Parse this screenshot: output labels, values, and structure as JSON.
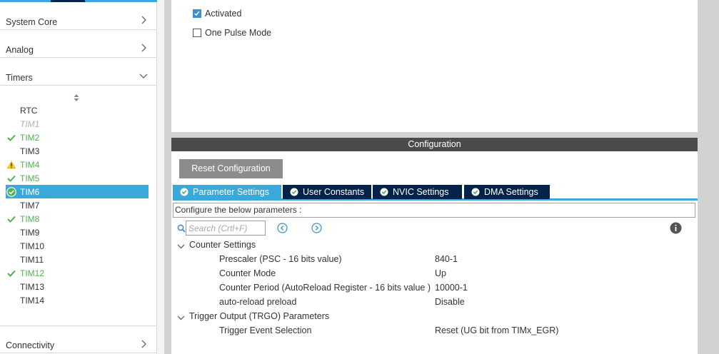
{
  "sidebar": {
    "categories": [
      {
        "label": "System Core",
        "state": "collapsed"
      },
      {
        "label": "Analog",
        "state": "collapsed"
      },
      {
        "label": "Timers",
        "state": "expanded"
      },
      {
        "label": "Connectivity",
        "state": "collapsed"
      }
    ],
    "timers": [
      {
        "label": "RTC",
        "status": "none"
      },
      {
        "label": "TIM1",
        "status": "disabled"
      },
      {
        "label": "TIM2",
        "status": "ok"
      },
      {
        "label": "TIM3",
        "status": "none"
      },
      {
        "label": "TIM4",
        "status": "warning"
      },
      {
        "label": "TIM5",
        "status": "ok"
      },
      {
        "label": "TIM6",
        "status": "selected"
      },
      {
        "label": "TIM7",
        "status": "none"
      },
      {
        "label": "TIM8",
        "status": "ok"
      },
      {
        "label": "TIM9",
        "status": "none"
      },
      {
        "label": "TIM10",
        "status": "none"
      },
      {
        "label": "TIM11",
        "status": "none"
      },
      {
        "label": "TIM12",
        "status": "ok"
      },
      {
        "label": "TIM13",
        "status": "none"
      },
      {
        "label": "TIM14",
        "status": "none"
      }
    ]
  },
  "mode": {
    "activated": {
      "label": "Activated",
      "checked": true
    },
    "one_pulse": {
      "label": "One Pulse Mode",
      "checked": false
    }
  },
  "config": {
    "header": "Configuration",
    "reset_button": "Reset Configuration",
    "tabs": [
      {
        "label": "Parameter Settings",
        "active": true
      },
      {
        "label": "User Constants",
        "active": false
      },
      {
        "label": "NVIC Settings",
        "active": false
      },
      {
        "label": "DMA Settings",
        "active": false
      }
    ],
    "describe": "Configure the below parameters :",
    "search_placeholder": "Search (Crtl+F)",
    "groups": [
      {
        "label": "Counter Settings",
        "params": [
          {
            "name": "Prescaler (PSC - 16 bits value)",
            "value": "840-1"
          },
          {
            "name": "Counter Mode",
            "value": "Up"
          },
          {
            "name": "Counter Period (AutoReload Register - 16 bits value )",
            "value": "10000-1"
          },
          {
            "name": "auto-reload preload",
            "value": "Disable"
          }
        ]
      },
      {
        "label": "Trigger Output (TRGO) Parameters",
        "params": [
          {
            "name": "Trigger Event Selection",
            "value": "Reset (UG bit from TIMx_EGR)"
          }
        ]
      }
    ]
  },
  "colors": {
    "accent_blue": "#39a9dc",
    "navy": "#03234b",
    "ok_green": "#52b153",
    "warning_yellow": "#f5c518"
  }
}
